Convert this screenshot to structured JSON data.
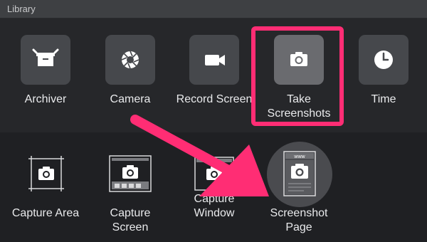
{
  "window": {
    "title": "Library"
  },
  "top_row": [
    {
      "label": "Archiver",
      "icon": "archive-box-icon"
    },
    {
      "label": "Camera",
      "icon": "aperture-icon"
    },
    {
      "label": "Record Screen",
      "icon": "video-camera-icon"
    },
    {
      "label": "Take\nScreenshots",
      "icon": "camera-icon",
      "selected": true
    },
    {
      "label": "Time",
      "icon": "clock-icon"
    }
  ],
  "bottom_row": [
    {
      "label": "Capture Area",
      "icon": "capture-area-icon"
    },
    {
      "label": "Capture\nScreen",
      "icon": "capture-screen-icon"
    },
    {
      "label": "Capture\nWindow",
      "icon": "capture-window-icon"
    },
    {
      "label": "Screenshot\nPage",
      "icon": "screenshot-page-icon",
      "badge_text": "www"
    }
  ],
  "colors": {
    "highlight": "#ff2d74",
    "arrow": "#ff2d74"
  }
}
